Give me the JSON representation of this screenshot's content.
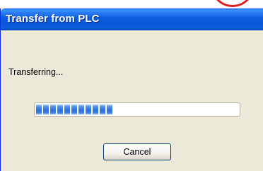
{
  "window": {
    "title": "Transfer from PLC"
  },
  "status": {
    "text": "Transferring..."
  },
  "progress": {
    "fraction": 0.5,
    "blocks_filled": 11
  },
  "buttons": {
    "cancel_label": "Cancel"
  },
  "colors": {
    "titlebar": "#0a5ae8",
    "dialog_background": "#ece9d8",
    "progress_block": "#2f71dc",
    "annotation_circle": "#e02020"
  }
}
